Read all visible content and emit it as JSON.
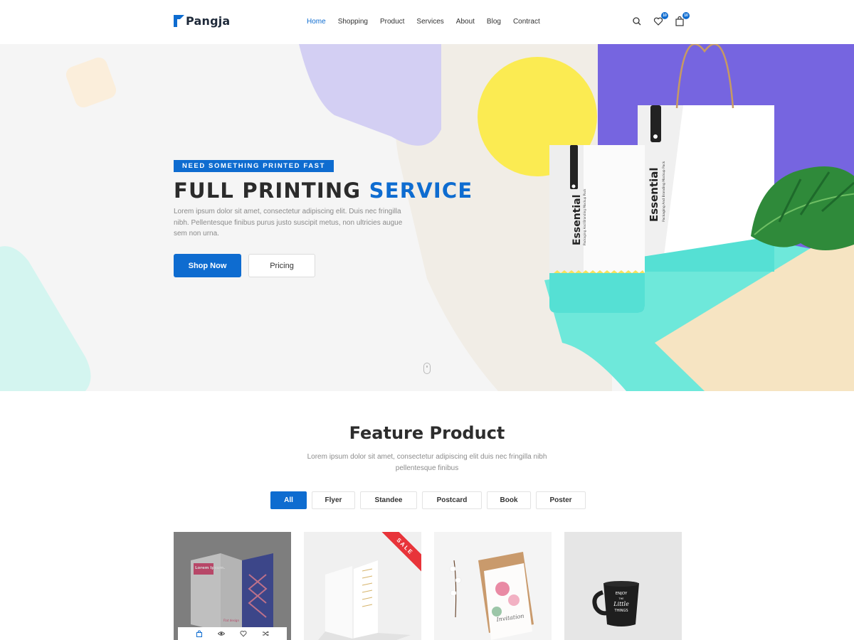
{
  "brand": {
    "name": "Pangja",
    "accent": "#0e6cd0"
  },
  "nav": {
    "items": [
      {
        "label": "Home",
        "active": true
      },
      {
        "label": "Shopping"
      },
      {
        "label": "Product"
      },
      {
        "label": "Services"
      },
      {
        "label": "About"
      },
      {
        "label": "Blog"
      },
      {
        "label": "Contract"
      }
    ]
  },
  "header_icons": {
    "search": "search-icon",
    "wishlist": {
      "icon": "heart-icon",
      "badge": "10"
    },
    "cart": {
      "icon": "shopping-bag-icon",
      "badge": "10"
    }
  },
  "hero": {
    "tagline": "NEED SOMETHING PRINTED FAST",
    "title_main": "FULL PRINTING",
    "title_accent": "SERVICE",
    "description": "Lorem ipsum dolor sit amet, consectetur adipiscing elit. Duis nec fringilla nibh. Pellentesque finibus purus justo suscipit metus, non ultricies augue sem non urna.",
    "primary_button": "Shop Now",
    "secondary_button": "Pricing",
    "scroll_icon": "mouse-scroll-icon",
    "pouch_brand": "Essential",
    "pouch_caption": "Packaging And Branding Mockup Pack",
    "bag_brand": "Essential",
    "bag_caption": "Packaging And Branding Mockup Pack"
  },
  "feature": {
    "title": "Feature Product",
    "description": "Lorem ipsum dolor sit amet, consectetur adipiscing elit duis nec fringilla nibh pellentesque finibus",
    "filters": [
      {
        "label": "All",
        "active": true
      },
      {
        "label": "Flyer"
      },
      {
        "label": "Standee"
      },
      {
        "label": "Postcard"
      },
      {
        "label": "Book"
      },
      {
        "label": "Poster"
      }
    ],
    "products": [
      {
        "name": "brochure",
        "overlay_text": "Lorem Ipsum.",
        "footer_text": "Flat design",
        "actions": [
          "shopping-bag-icon",
          "eye-icon",
          "heart-icon",
          "shuffle-icon"
        ]
      },
      {
        "name": "standee-cards",
        "ribbon": "SALE"
      },
      {
        "name": "invitation-card",
        "card_text": "Invitation"
      },
      {
        "name": "mug",
        "mug_text": [
          "ENJOY",
          "THE",
          "Little",
          "THINGS"
        ]
      }
    ]
  }
}
